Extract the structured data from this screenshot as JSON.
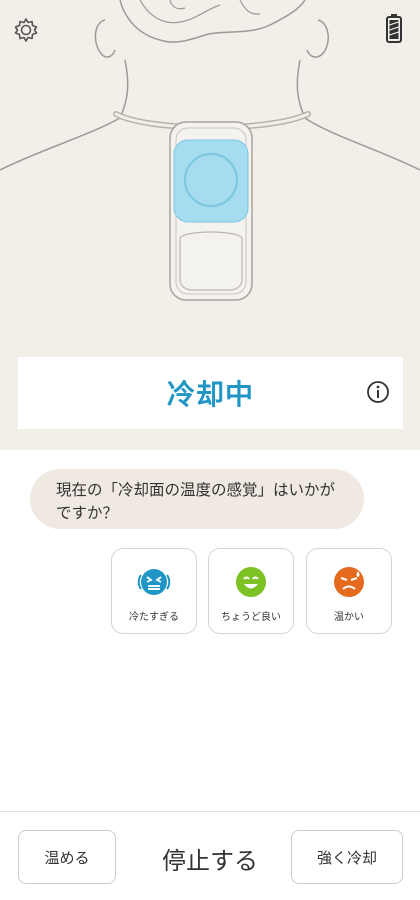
{
  "status": {
    "label": "冷却中"
  },
  "question": {
    "text": "現在の「冷却面の温度の感覚」はいかがですか？"
  },
  "choices": [
    {
      "label": "冷たすぎる",
      "icon": "too-cold-face-icon",
      "color": "#1f96c6"
    },
    {
      "label": "ちょうど良い",
      "icon": "happy-face-icon",
      "color": "#7cc225"
    },
    {
      "label": "温かい",
      "icon": "hot-face-icon",
      "color": "#e56a1e"
    }
  ],
  "controls": {
    "warm_label": "温める",
    "stop_label": "停止する",
    "strong_cool_label": "強く冷却"
  },
  "icons": {
    "settings": "gear-icon",
    "battery": "battery-icon",
    "info": "info-icon"
  }
}
